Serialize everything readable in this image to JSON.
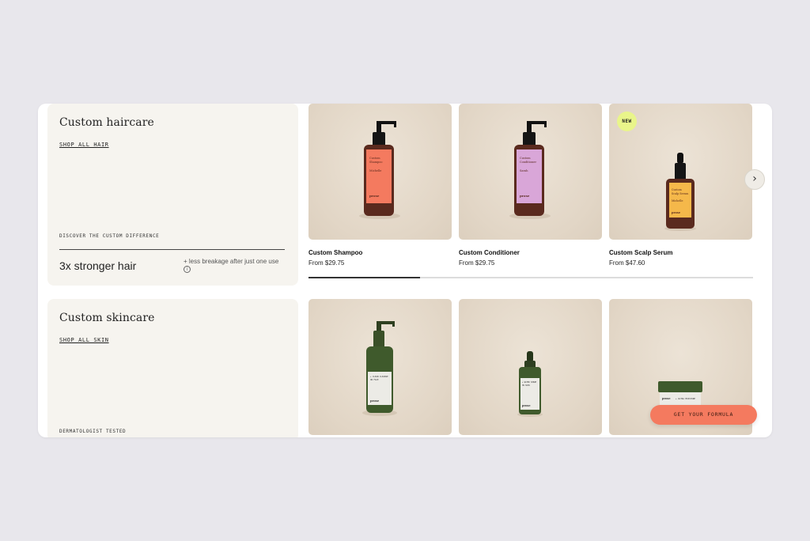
{
  "hair_section": {
    "title": "Custom haircare",
    "link": "SHOP ALL HAIR",
    "caption": "DISCOVER THE CUSTOM DIFFERENCE",
    "stat_big": "3x stronger hair",
    "stat_small": "+ less breakage after just one use",
    "info_icon": "i",
    "products": [
      {
        "name": "Custom Shampoo",
        "price": "From $29.75",
        "label_color": "#f47a5f",
        "bottle": "pump",
        "badge": ""
      },
      {
        "name": "Custom Conditioner",
        "price": "From $29.75",
        "label_color": "#d9a6d8",
        "bottle": "pump",
        "badge": ""
      },
      {
        "name": "Custom Scalp Serum",
        "price": "From $47.60",
        "label_color": "#f5b84a",
        "bottle": "dropper",
        "badge": "NEW"
      }
    ],
    "next_icon": "›",
    "scroll_progress": 0.25
  },
  "skin_section": {
    "title": "Custom skincare",
    "link": "SHOP ALL SKIN",
    "caption": "DERMATOLOGIST TESTED",
    "products": [
      {
        "bottle": "pump-green"
      },
      {
        "bottle": "dropper-green"
      },
      {
        "bottle": "jar-green"
      }
    ]
  },
  "cta": {
    "label": "GET YOUR FORMULA",
    "color": "#f47a5f"
  },
  "brand": {
    "bottle_amber": "#5a2a1e",
    "bottle_green": "#3f5a2c"
  }
}
